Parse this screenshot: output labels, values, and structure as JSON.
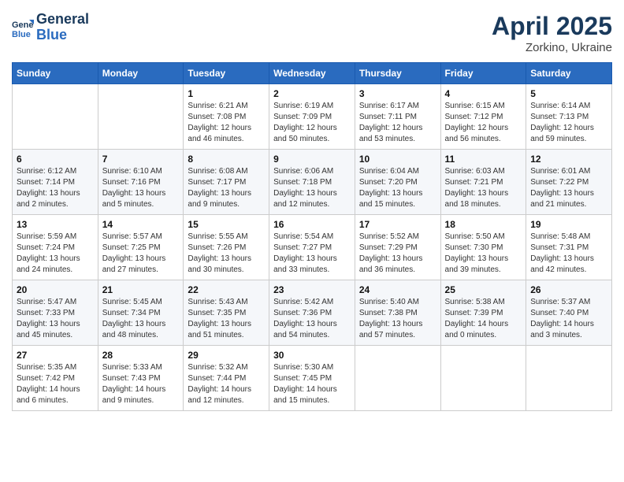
{
  "header": {
    "logo_line1": "General",
    "logo_line2": "Blue",
    "month": "April 2025",
    "location": "Zorkino, Ukraine"
  },
  "weekdays": [
    "Sunday",
    "Monday",
    "Tuesday",
    "Wednesday",
    "Thursday",
    "Friday",
    "Saturday"
  ],
  "weeks": [
    [
      {
        "day": "",
        "detail": ""
      },
      {
        "day": "",
        "detail": ""
      },
      {
        "day": "1",
        "detail": "Sunrise: 6:21 AM\nSunset: 7:08 PM\nDaylight: 12 hours and 46 minutes."
      },
      {
        "day": "2",
        "detail": "Sunrise: 6:19 AM\nSunset: 7:09 PM\nDaylight: 12 hours and 50 minutes."
      },
      {
        "day": "3",
        "detail": "Sunrise: 6:17 AM\nSunset: 7:11 PM\nDaylight: 12 hours and 53 minutes."
      },
      {
        "day": "4",
        "detail": "Sunrise: 6:15 AM\nSunset: 7:12 PM\nDaylight: 12 hours and 56 minutes."
      },
      {
        "day": "5",
        "detail": "Sunrise: 6:14 AM\nSunset: 7:13 PM\nDaylight: 12 hours and 59 minutes."
      }
    ],
    [
      {
        "day": "6",
        "detail": "Sunrise: 6:12 AM\nSunset: 7:14 PM\nDaylight: 13 hours and 2 minutes."
      },
      {
        "day": "7",
        "detail": "Sunrise: 6:10 AM\nSunset: 7:16 PM\nDaylight: 13 hours and 5 minutes."
      },
      {
        "day": "8",
        "detail": "Sunrise: 6:08 AM\nSunset: 7:17 PM\nDaylight: 13 hours and 9 minutes."
      },
      {
        "day": "9",
        "detail": "Sunrise: 6:06 AM\nSunset: 7:18 PM\nDaylight: 13 hours and 12 minutes."
      },
      {
        "day": "10",
        "detail": "Sunrise: 6:04 AM\nSunset: 7:20 PM\nDaylight: 13 hours and 15 minutes."
      },
      {
        "day": "11",
        "detail": "Sunrise: 6:03 AM\nSunset: 7:21 PM\nDaylight: 13 hours and 18 minutes."
      },
      {
        "day": "12",
        "detail": "Sunrise: 6:01 AM\nSunset: 7:22 PM\nDaylight: 13 hours and 21 minutes."
      }
    ],
    [
      {
        "day": "13",
        "detail": "Sunrise: 5:59 AM\nSunset: 7:24 PM\nDaylight: 13 hours and 24 minutes."
      },
      {
        "day": "14",
        "detail": "Sunrise: 5:57 AM\nSunset: 7:25 PM\nDaylight: 13 hours and 27 minutes."
      },
      {
        "day": "15",
        "detail": "Sunrise: 5:55 AM\nSunset: 7:26 PM\nDaylight: 13 hours and 30 minutes."
      },
      {
        "day": "16",
        "detail": "Sunrise: 5:54 AM\nSunset: 7:27 PM\nDaylight: 13 hours and 33 minutes."
      },
      {
        "day": "17",
        "detail": "Sunrise: 5:52 AM\nSunset: 7:29 PM\nDaylight: 13 hours and 36 minutes."
      },
      {
        "day": "18",
        "detail": "Sunrise: 5:50 AM\nSunset: 7:30 PM\nDaylight: 13 hours and 39 minutes."
      },
      {
        "day": "19",
        "detail": "Sunrise: 5:48 AM\nSunset: 7:31 PM\nDaylight: 13 hours and 42 minutes."
      }
    ],
    [
      {
        "day": "20",
        "detail": "Sunrise: 5:47 AM\nSunset: 7:33 PM\nDaylight: 13 hours and 45 minutes."
      },
      {
        "day": "21",
        "detail": "Sunrise: 5:45 AM\nSunset: 7:34 PM\nDaylight: 13 hours and 48 minutes."
      },
      {
        "day": "22",
        "detail": "Sunrise: 5:43 AM\nSunset: 7:35 PM\nDaylight: 13 hours and 51 minutes."
      },
      {
        "day": "23",
        "detail": "Sunrise: 5:42 AM\nSunset: 7:36 PM\nDaylight: 13 hours and 54 minutes."
      },
      {
        "day": "24",
        "detail": "Sunrise: 5:40 AM\nSunset: 7:38 PM\nDaylight: 13 hours and 57 minutes."
      },
      {
        "day": "25",
        "detail": "Sunrise: 5:38 AM\nSunset: 7:39 PM\nDaylight: 14 hours and 0 minutes."
      },
      {
        "day": "26",
        "detail": "Sunrise: 5:37 AM\nSunset: 7:40 PM\nDaylight: 14 hours and 3 minutes."
      }
    ],
    [
      {
        "day": "27",
        "detail": "Sunrise: 5:35 AM\nSunset: 7:42 PM\nDaylight: 14 hours and 6 minutes."
      },
      {
        "day": "28",
        "detail": "Sunrise: 5:33 AM\nSunset: 7:43 PM\nDaylight: 14 hours and 9 minutes."
      },
      {
        "day": "29",
        "detail": "Sunrise: 5:32 AM\nSunset: 7:44 PM\nDaylight: 14 hours and 12 minutes."
      },
      {
        "day": "30",
        "detail": "Sunrise: 5:30 AM\nSunset: 7:45 PM\nDaylight: 14 hours and 15 minutes."
      },
      {
        "day": "",
        "detail": ""
      },
      {
        "day": "",
        "detail": ""
      },
      {
        "day": "",
        "detail": ""
      }
    ]
  ]
}
